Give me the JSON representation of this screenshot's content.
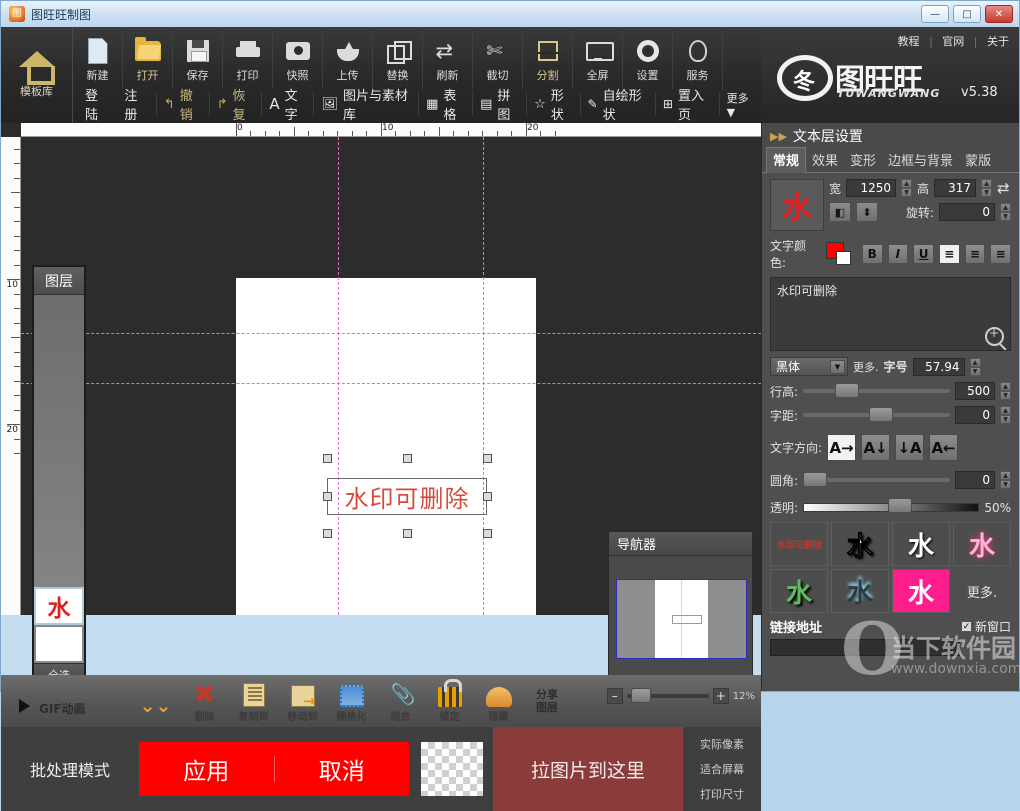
{
  "window": {
    "title": "图旺旺制图",
    "minimize": "—",
    "maximize": "□",
    "close": "✕"
  },
  "ribbon": {
    "template_library": "模板库",
    "items": [
      {
        "label": "新建",
        "icon": "new-document-icon"
      },
      {
        "label": "打开",
        "icon": "open-folder-icon"
      },
      {
        "label": "保存",
        "icon": "save-icon"
      },
      {
        "label": "打印",
        "icon": "print-icon"
      },
      {
        "label": "快照",
        "icon": "camera-icon"
      },
      {
        "label": "上传",
        "icon": "upload-icon"
      },
      {
        "label": "替换",
        "icon": "replace-icon"
      },
      {
        "label": "刷新",
        "icon": "refresh-icon"
      },
      {
        "label": "截切",
        "icon": "scissors-icon"
      },
      {
        "label": "分割",
        "icon": "split-icon"
      },
      {
        "label": "全屏",
        "icon": "fullscreen-icon"
      },
      {
        "label": "设置",
        "icon": "gear-icon"
      },
      {
        "label": "服务",
        "icon": "qq-icon"
      }
    ],
    "login": "登陆",
    "register": "注册",
    "row2": [
      {
        "label": "撤销",
        "icon": "undo-icon"
      },
      {
        "label": "恢复",
        "icon": "redo-icon"
      },
      {
        "label": "文字",
        "icon": "text-icon"
      },
      {
        "label": "图片与素材库",
        "icon": "image-library-icon"
      },
      {
        "label": "表格",
        "icon": "table-icon"
      },
      {
        "label": "拼图",
        "icon": "collage-icon"
      },
      {
        "label": "形状",
        "icon": "shape-star-icon"
      },
      {
        "label": "自绘形状",
        "icon": "pen-icon"
      },
      {
        "label": "置入页",
        "icon": "insert-page-icon"
      },
      {
        "label": "更多▼",
        "icon": "more-icon"
      }
    ]
  },
  "logo": {
    "links": [
      "教程",
      "官网",
      "关于"
    ],
    "mark_char": "冬",
    "name_cn": "图旺旺",
    "name_en": "TUWANGWANG",
    "version": "v5.38"
  },
  "canvas": {
    "unit": "厘米",
    "ruler_h_labels": [
      "0",
      "10",
      "20"
    ],
    "ruler_v_labels": [
      "10",
      "20"
    ],
    "selected_text": "水印可删除"
  },
  "layers": {
    "title": "图层",
    "select_all": "全选",
    "items": [
      {
        "thumb": "水",
        "selected": true
      },
      {
        "thumb": "",
        "selected": false
      }
    ]
  },
  "navigator": {
    "title": "导航器"
  },
  "objbar": {
    "gif": "GIF动画",
    "play_icon": "play-icon",
    "items": [
      {
        "label": "",
        "icon": "chevron-double-down-icon"
      },
      {
        "label": "删除",
        "icon": "delete-x-icon"
      },
      {
        "label": "复制到",
        "icon": "copy-to-icon"
      },
      {
        "label": "移动到",
        "icon": "move-to-icon"
      },
      {
        "label": "栅格化",
        "icon": "rasterize-icon"
      },
      {
        "label": "组合",
        "icon": "group-clip-icon"
      },
      {
        "label": "锁定",
        "icon": "lock-icon"
      },
      {
        "label": "隐藏",
        "icon": "hide-icon"
      }
    ],
    "share_layer": "分享\n图层",
    "share_line1": "分享",
    "share_line2": "图层",
    "zoom_minus": "–",
    "zoom_plus": "+",
    "zoom_value": "12%"
  },
  "batchbar": {
    "mode": "批处理模式",
    "apply": "应用",
    "cancel": "取消",
    "drop_zone": "拉图片到这里",
    "view_options": [
      "实际像素",
      "适合屏幕",
      "打印尺寸"
    ]
  },
  "rpanel": {
    "title": "文本层设置",
    "collapse_icon": "double-arrow-right-icon",
    "tabs": [
      {
        "label": "常规",
        "active": true
      },
      {
        "label": "效果",
        "active": false
      },
      {
        "label": "变形",
        "active": false
      },
      {
        "label": "边框与背景",
        "active": false
      },
      {
        "label": "蒙版",
        "active": false
      }
    ],
    "preview_char": "水",
    "width_label": "宽",
    "width_value": "1250",
    "height_label": "高",
    "height_value": "317",
    "link_icon": "link-ratio-icon",
    "flip_h_icon": "flip-horizontal-icon",
    "flip_v_icon": "flip-vertical-icon",
    "rotate_label": "旋转:",
    "rotate_value": "0",
    "color_label": "文字颜色:",
    "color_value": "#ff0000",
    "bold": "B",
    "italic": "I",
    "underline": "U",
    "align_left_icon": "align-left-icon",
    "align_center_icon": "align-center-icon",
    "align_right_icon": "align-right-icon",
    "text_content": "水印可删除",
    "zoom_text_icon": "magnifier-plus-icon",
    "font_family": "黑体",
    "font_more": "更多.",
    "font_size_label": "字号",
    "font_size_value": "57.94",
    "line_height_label": "行高:",
    "line_height_value": "500",
    "char_spacing_label": "字距:",
    "char_spacing_value": "0",
    "text_direction_label": "文字方向:",
    "direction_buttons": [
      "A→",
      "A↓",
      "↓A",
      "A←"
    ],
    "corner_label": "圆角:",
    "corner_value": "0",
    "opacity_label": "透明:",
    "opacity_value": "50%",
    "presets": [
      "水印可删除",
      "水",
      "水",
      "水",
      "水",
      "水",
      "水"
    ],
    "preset_more": "更多.",
    "link_address_label": "链接地址",
    "new_window_label": "新窗口",
    "new_window_checked": "✓"
  },
  "watermark": {
    "letter": "O",
    "brand": "当下软件园",
    "url": "www.downxia.com"
  }
}
